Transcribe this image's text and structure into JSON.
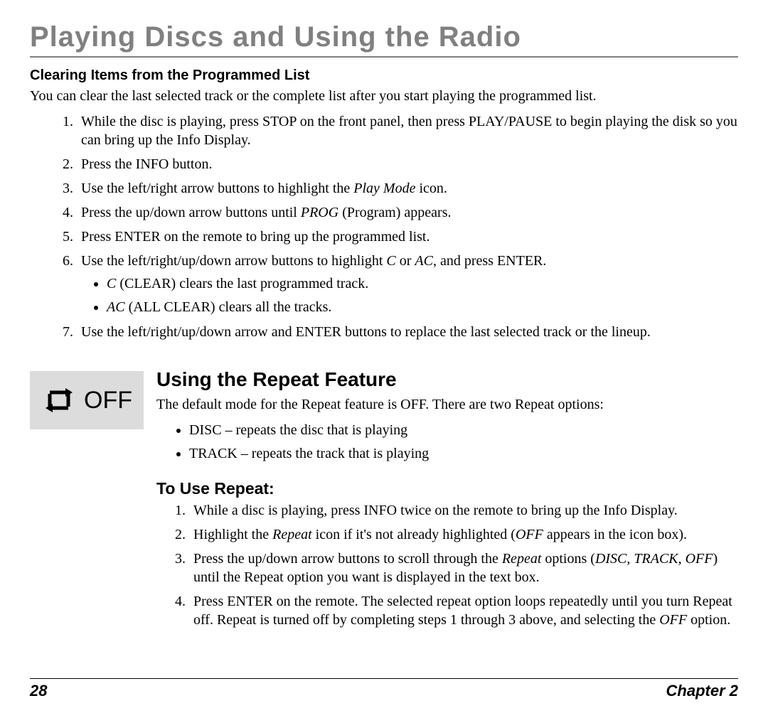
{
  "title": "Playing Discs and Using the Radio",
  "clearing": {
    "heading": "Clearing Items from the Programmed List",
    "intro": "You can clear the last selected track or the complete list after you start playing the programmed list.",
    "steps": [
      "While the disc is playing, press STOP on the front panel, then press PLAY/PAUSE to begin playing the disk so you can bring up the Info Display.",
      "Press the INFO button.",
      {
        "pre": "Use the left/right arrow buttons to highlight the ",
        "em": "Play Mode",
        "post": " icon."
      },
      {
        "pre": "Press the up/down arrow buttons until ",
        "em": "PROG",
        "post": " (Program) appears."
      },
      "Press ENTER on the remote to bring up the programmed list.",
      {
        "pre": "Use the left/right/up/down arrow buttons to highlight ",
        "em": "C",
        "mid": " or ",
        "em2": "AC",
        "post": ", and press ENTER.",
        "bullets": [
          {
            "em": "C",
            "text": " (CLEAR) clears the last programmed track."
          },
          {
            "em": "AC",
            "text": " (ALL CLEAR) clears all the tracks."
          }
        ]
      },
      "Use the left/right/up/down arrow and ENTER buttons to replace the last selected track or the lineup."
    ]
  },
  "repeat": {
    "icon_label": "OFF",
    "heading": "Using the Repeat Feature",
    "intro": "The default mode for the Repeat feature is OFF. There are two Repeat options:",
    "options": [
      "DISC – repeats the disc that is playing",
      "TRACK – repeats the track that is playing"
    ],
    "touse_heading": "To Use Repeat:",
    "touse_steps": [
      "While a disc is playing, press INFO twice on the remote to bring up the Info Display.",
      {
        "pre": "Highlight the ",
        "em": "Repeat",
        "mid": " icon if it's not already highlighted (",
        "em2": "OFF",
        "post": " appears in the icon box)."
      },
      {
        "pre": "Press the up/down arrow buttons to scroll through the ",
        "em": "Repeat",
        "mid": " options (",
        "em2": "DISC, TRACK, OFF",
        "post": ") until the Repeat option you want is displayed in the text box."
      },
      {
        "pre": "Press ENTER on the remote. The selected repeat option loops repeatedly until you turn Repeat off. Repeat is turned off by completing steps 1 through 3 above, and selecting the ",
        "em": "OFF",
        "post": " option."
      }
    ]
  },
  "footer": {
    "page": "28",
    "chapter": "Chapter 2"
  }
}
